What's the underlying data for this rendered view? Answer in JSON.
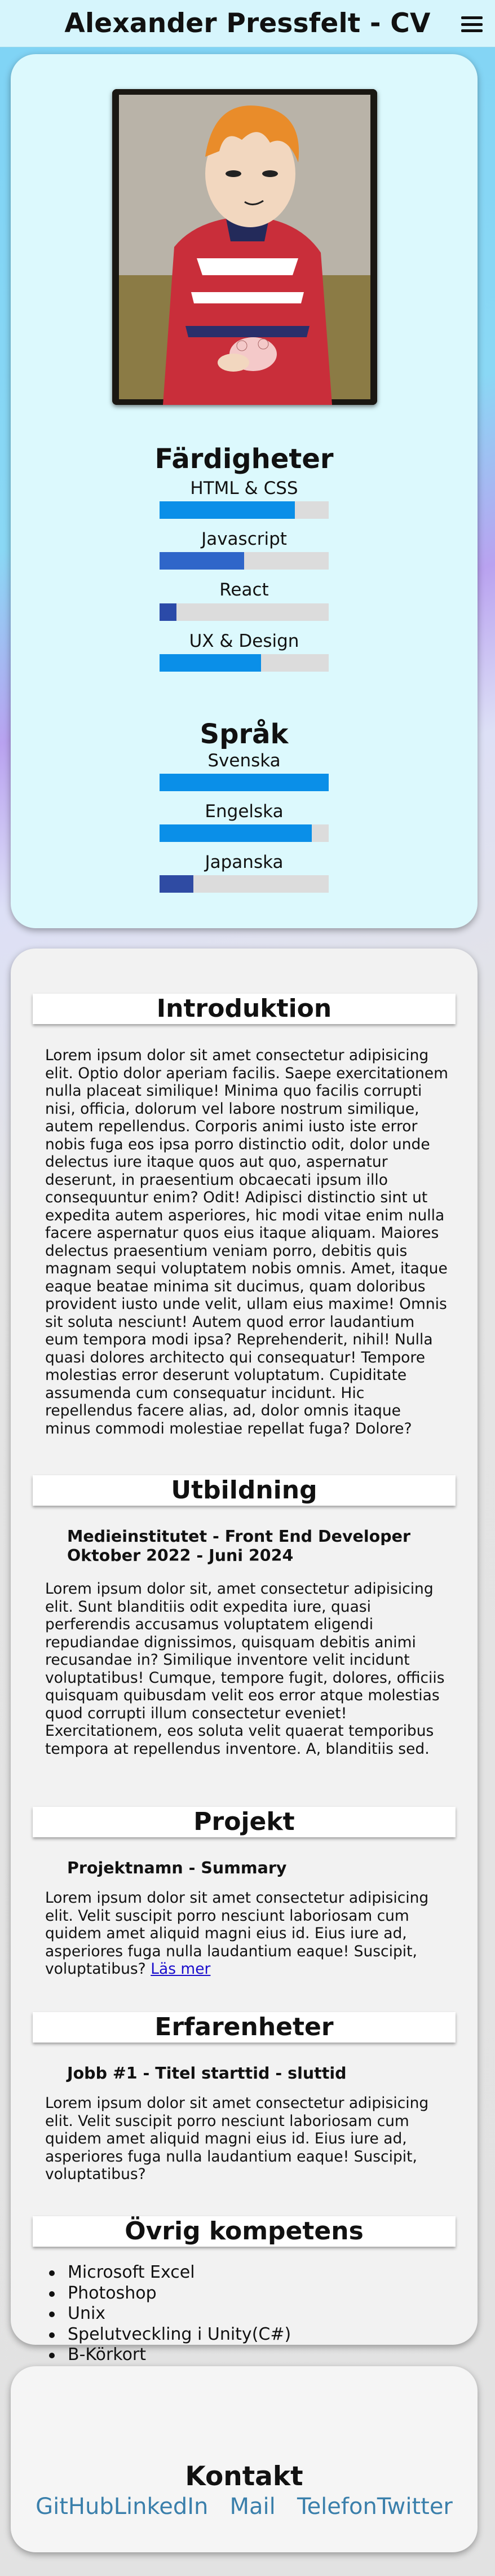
{
  "header": {
    "title": "Alexander Pressfelt - CV",
    "menu_icon": "hamburger-menu-icon"
  },
  "profile": {
    "photo_alt": "Profilbild",
    "skills": {
      "title": "Färdigheter",
      "items": [
        {
          "label": "HTML & CSS",
          "level": 0.8,
          "color": "#0a8fe8"
        },
        {
          "label": "Javascript",
          "level": 0.5,
          "color": "#2f66c9"
        },
        {
          "label": "React",
          "level": 0.1,
          "color": "#2b4aa8"
        },
        {
          "label": "UX & Design",
          "level": 0.6,
          "color": "#0a8fe8"
        }
      ]
    },
    "languages": {
      "title": "Språk",
      "items": [
        {
          "label": "Svenska",
          "level": 1.0,
          "color": "#0a8fe8"
        },
        {
          "label": "Engelska",
          "level": 0.9,
          "color": "#0a8fe8"
        },
        {
          "label": "Japanska",
          "level": 0.2,
          "color": "#2f4ba3"
        }
      ]
    }
  },
  "main": {
    "intro": {
      "heading": "Introduktion",
      "text": "Lorem ipsum dolor sit amet consectetur adipisicing elit. Optio dolor aperiam facilis. Saepe exercitationem nulla placeat similique! Minima quo facilis corrupti nisi, officia, dolorum vel labore nostrum similique, autem repellendus. Corporis animi iusto iste error nobis fuga eos ipsa porro distinctio odit, dolor unde delectus iure itaque quos aut quo, aspernatur deserunt, in praesentium obcaecati ipsum illo consequuntur enim? Odit! Adipisci distinctio sint ut expedita autem asperiores, hic modi vitae enim nulla facere aspernatur quos eius itaque aliquam. Maiores delectus praesentium veniam porro, debitis quis magnam sequi voluptatem nobis omnis. Amet, itaque eaque beatae minima sit ducimus, quam doloribus provident iusto unde velit, ullam eius maxime! Omnis sit soluta nesciunt! Autem quod error laudantium eum tempora modi ipsa? Reprehenderit, nihil! Nulla quasi dolores architecto qui consequatur! Tempore molestias error deserunt voluptatum. Cupiditate assumenda cum consequatur incidunt. Hic repellendus facere alias, ad, dolor omnis itaque minus commodi molestiae repellat fuga? Dolore?"
    },
    "education": {
      "heading": "Utbildning",
      "title_line1": "Medieinstitutet - Front End Developer",
      "title_line2": "Oktober 2022 - Juni 2024",
      "text": "Lorem ipsum dolor sit, amet consectetur adipisicing elit. Sunt blanditiis odit expedita iure, quasi perferendis accusamus voluptatem eligendi repudiandae dignissimos, quisquam debitis animi recusandae in? Similique inventore velit incidunt voluptatibus! Cumque, tempore fugit, dolores, officiis quisquam quibusdam velit eos error atque molestias quod corrupti illum consectetur eveniet! Exercitationem, eos soluta velit quaerat temporibus tempora at repellendus inventore. A, blanditiis sed."
    },
    "projects": {
      "heading": "Projekt",
      "title": "Projektnamn - Summary",
      "text": "Lorem ipsum dolor sit amet consectetur adipisicing elit. Velit suscipit porro nesciunt laboriosam cum quidem amet aliquid magni eius id. Eius iure ad, asperiores fuga nulla laudantium eaque! Suscipit, voluptatibus?",
      "link": "Läs mer"
    },
    "experience": {
      "heading": "Erfarenheter",
      "title": "Jobb #1 - Titel starttid - sluttid",
      "text": "Lorem ipsum dolor sit amet consectetur adipisicing elit. Velit suscipit porro nesciunt laboriosam cum quidem amet aliquid magni eius id. Eius iure ad, asperiores fuga nulla laudantium eaque! Suscipit, voluptatibus?"
    },
    "other": {
      "heading": "Övrig kompetens",
      "items": [
        "Microsoft Excel",
        "Photoshop",
        "Unix",
        "Spelutveckling i Unity(C#)",
        "B-Körkort"
      ]
    }
  },
  "contact": {
    "title": "Kontakt",
    "links": [
      "GitHub",
      "LinkedIn",
      "Mail",
      "Telefon",
      "Twitter"
    ]
  }
}
